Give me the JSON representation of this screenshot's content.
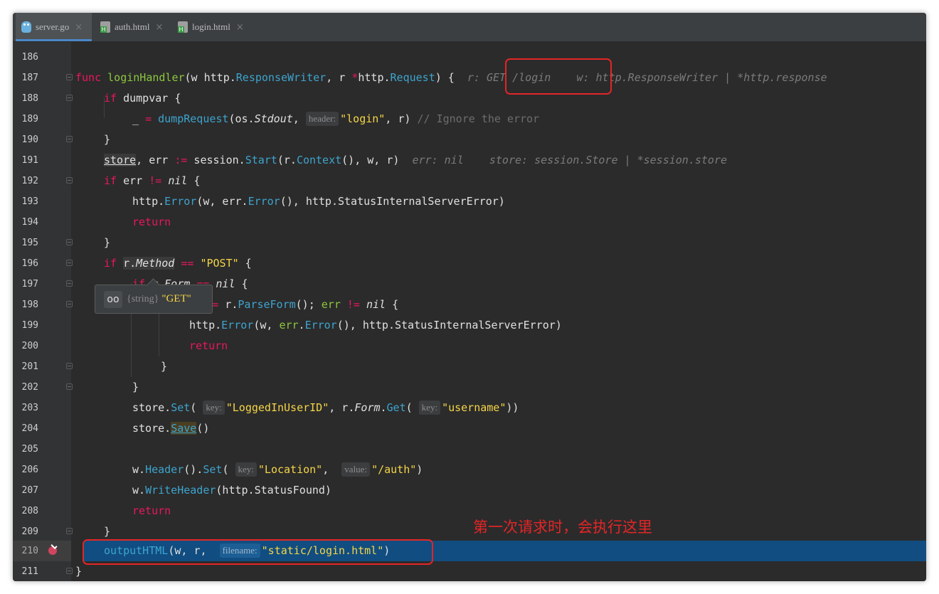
{
  "tabs": [
    {
      "label": "server.go",
      "icon": "go-file-icon",
      "active": true
    },
    {
      "label": "auth.html",
      "icon": "html-file-icon",
      "active": false
    },
    {
      "label": "login.html",
      "icon": "html-file-icon",
      "active": false
    }
  ],
  "close_glyph": "×",
  "lines": {
    "n186": "186",
    "n187": "187",
    "n188": "188",
    "n189": "189",
    "n190": "190",
    "n191": "191",
    "n192": "192",
    "n193": "193",
    "n194": "194",
    "n195": "195",
    "n196": "196",
    "n197": "197",
    "n198": "198",
    "n199": "199",
    "n200": "200",
    "n201": "201",
    "n202": "202",
    "n203": "203",
    "n204": "204",
    "n205": "205",
    "n206": "206",
    "n207": "207",
    "n208": "208",
    "n209": "209",
    "n210": "210",
    "n211": "211"
  },
  "hints": {
    "header": "header:",
    "key": "key:",
    "value": "value:",
    "filename": "filename:"
  },
  "inline_values": {
    "l187_r": "r: GET /login",
    "l187_w": "w: http.ResponseWriter | *http.response",
    "l191_err": "err: nil",
    "l191_store": "store: session.Store | *session.store"
  },
  "tooltip": {
    "type": "{string}",
    "value": "\"GET\""
  },
  "annotation": "第一次请求时，会执行这里",
  "colors": {
    "keyword": "#e8175d",
    "function": "#8ec63f",
    "type": "#3da4ce",
    "string": "#f5d547",
    "exec_line": "#114d80",
    "annotation_red": "#e42526"
  }
}
